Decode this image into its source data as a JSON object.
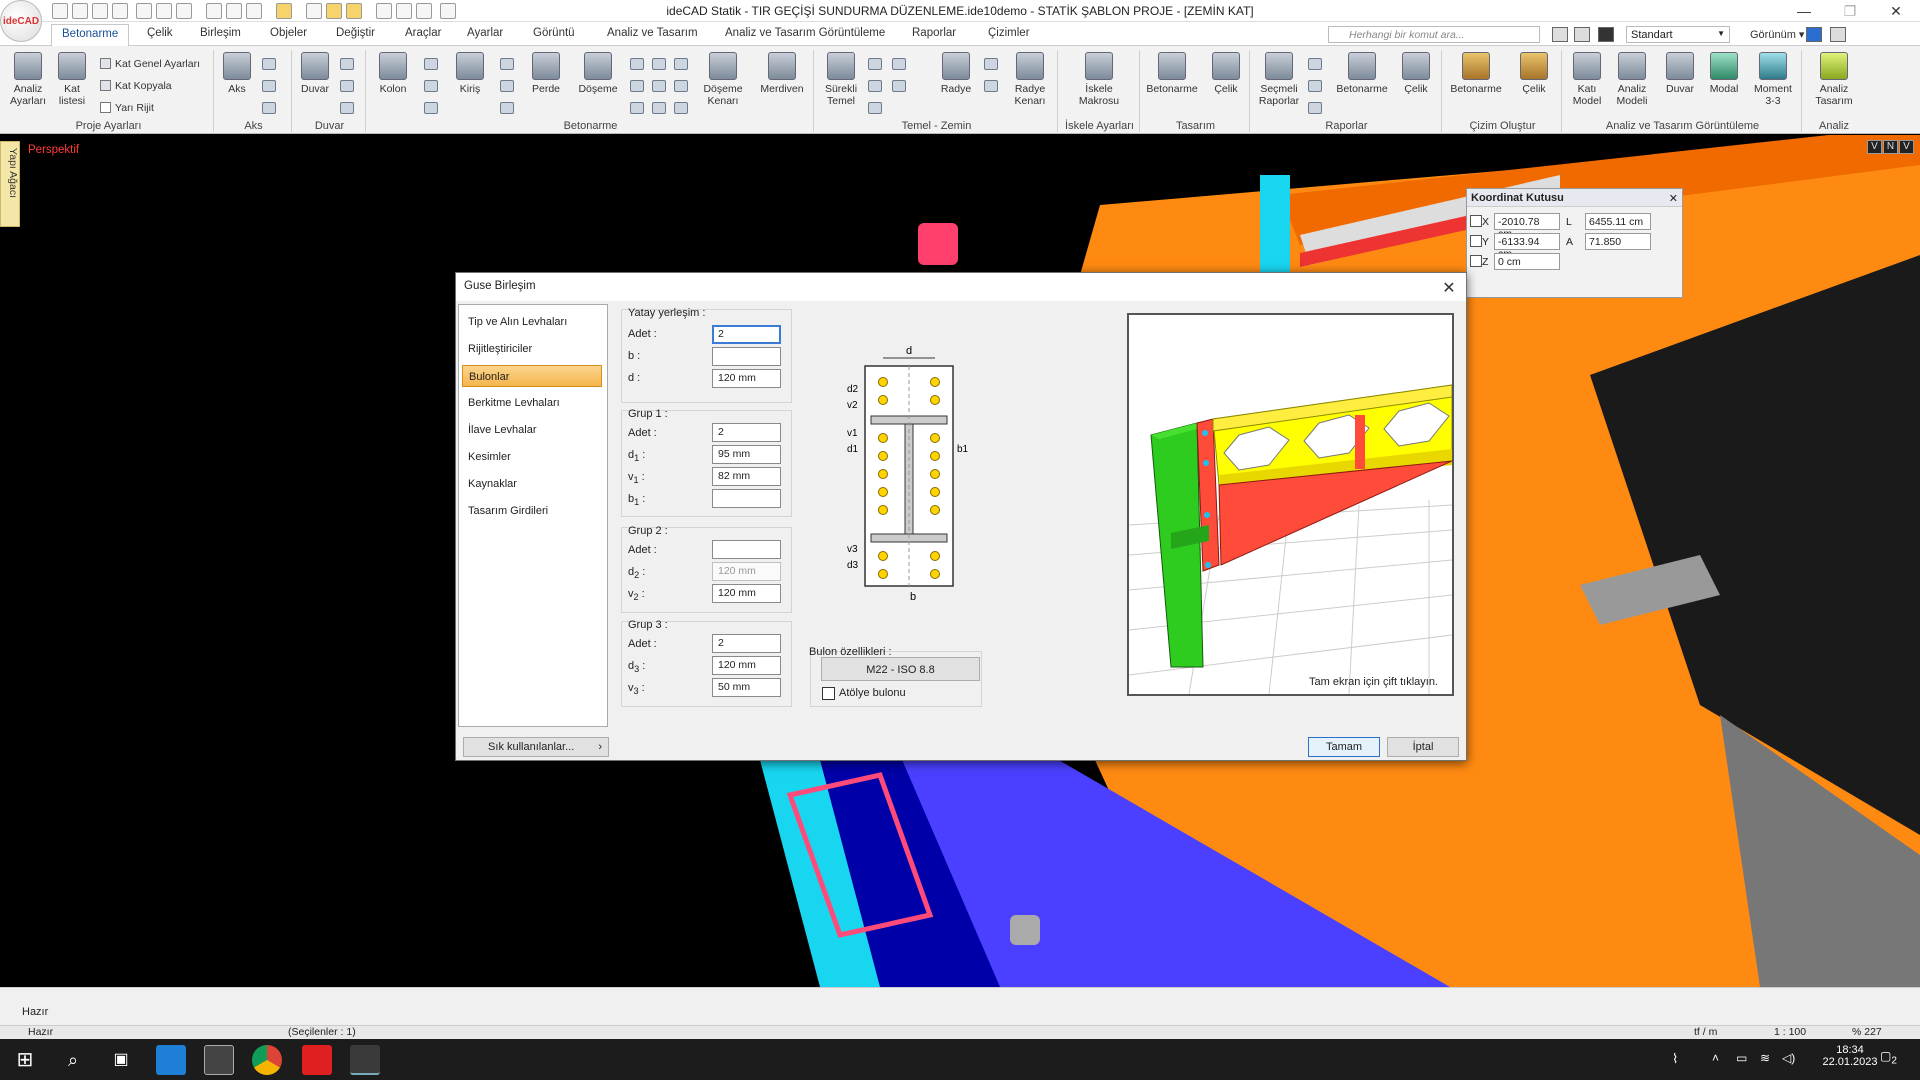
{
  "app": {
    "logo": "ideCAD",
    "title": "ideCAD Statik - TIR GEÇİŞİ SUNDURMA DÜZENLEME.ide10demo - STATİK ŞABLON PROJE - [ZEMİN KAT]",
    "winbtns": {
      "min": "—",
      "max": "❐",
      "close": "✕"
    }
  },
  "menu": {
    "tabs": [
      "Betonarme",
      "Çelik",
      "Birleşim",
      "Objeler",
      "Değiştir",
      "Araçlar",
      "Ayarlar",
      "Görüntü",
      "Analiz ve Tasarım",
      "Analiz ve Tasarım Görüntüleme",
      "Raporlar",
      "Çizimler"
    ],
    "search_placeholder": "Herhangi bir komut ara...",
    "style_value": "Standart",
    "view_label": "Görünüm"
  },
  "ribbon": {
    "groups": {
      "proje": {
        "label": "Proje Ayarları",
        "big": [
          "Analiz Ayarları",
          "Kat listesi"
        ],
        "small": [
          "Kat Genel Ayarları",
          "Kat Kopyala",
          "Yarı Rijit"
        ]
      },
      "aks": {
        "label": "Aks",
        "big": [
          "Aks"
        ]
      },
      "duvar": {
        "label": "Duvar",
        "big": [
          "Duvar"
        ]
      },
      "betonarme": {
        "label": "Betonarme",
        "big": [
          "Kolon",
          "Kiriş",
          "Perde",
          "Döşeme",
          "Döşeme Kenarı",
          "Merdiven"
        ]
      },
      "temel": {
        "label": "Temel - Zemin",
        "big": [
          "Sürekli Temel",
          "Radye",
          "Radye Kenarı"
        ]
      },
      "iskele": {
        "label": "İskele Ayarları",
        "big": [
          "İskele Makrosu"
        ]
      },
      "tasarim": {
        "label": "Tasarım",
        "big": [
          "Betonarme",
          "Çelik"
        ]
      },
      "raporlar": {
        "label": "Raporlar",
        "big": [
          "Seçmeli Raporlar",
          "Betonarme",
          "Çelik"
        ]
      },
      "cizim": {
        "label": "Çizim Oluştur",
        "big": [
          "Betonarme",
          "Çelik"
        ]
      },
      "analizgor": {
        "label": "Analiz ve Tasarım Görüntüleme",
        "big": [
          "Katı Model",
          "Analiz Modeli",
          "Duvar",
          "Modal",
          "Moment 3-3"
        ]
      },
      "analiz": {
        "label": "Analiz",
        "big": [
          "Analiz Tasarım"
        ]
      }
    }
  },
  "viewport": {
    "side_tab": "Yapı Ağacı",
    "perspective_label": "Perspektif",
    "view_buttons": [
      "V",
      "N",
      "V"
    ]
  },
  "coordbox": {
    "title": "Koordinat Kutusu",
    "x_label": "X",
    "x_value": "-2010.78 cm",
    "y_label": "Y",
    "y_value": "-6133.94 cm",
    "z_label": "Z",
    "z_value": "0 cm",
    "l_label": "L",
    "l_value": "6455.11 cm",
    "a_label": "A",
    "a_value": "71.850"
  },
  "dialog": {
    "title": "Guse Birleşim",
    "nav": [
      "Tip ve Alın Levhaları",
      "Rijitleştiriciler",
      "Bulonlar",
      "Berkitme Levhaları",
      "İlave Levhalar",
      "Kesimler",
      "Kaynaklar",
      "Tasarım Girdileri"
    ],
    "yatay": {
      "legend": "Yatay yerleşim :",
      "adet_label": "Adet :",
      "adet": "2",
      "b_label": "b :",
      "b": "",
      "d_label": "d :",
      "d": "120 mm"
    },
    "grup1": {
      "legend": "Grup 1 :",
      "adet_label": "Adet :",
      "adet": "2",
      "d1_label": "d",
      "d1_sub": "1",
      "d1": "95 mm",
      "v1_label": "v",
      "v1_sub": "1",
      "v1": "82 mm",
      "b1_label": "b",
      "b1_sub": "1",
      "b1": ""
    },
    "grup2": {
      "legend": "Grup 2 :",
      "adet_label": "Adet :",
      "adet": "",
      "d2_label": "d",
      "d2_sub": "2",
      "d2": "120 mm",
      "v2_label": "v",
      "v2_sub": "2",
      "v2": "120 mm"
    },
    "grup3": {
      "legend": "Grup 3 :",
      "adet_label": "Adet :",
      "adet": "2",
      "d3_label": "d",
      "d3_sub": "3",
      "d3": "120 mm",
      "v3_label": "v",
      "v3_sub": "3",
      "v3": "50 mm"
    },
    "bolt": {
      "legend": "Bulon özellikleri :",
      "grade": "M22 - ISO 8.8",
      "workshop_label": "Atölye bulonu"
    },
    "drawing": {
      "d": "d",
      "b": "b",
      "d2": "d2",
      "v2": "v2",
      "v1": "v1",
      "d1": "d1",
      "b1": "b1",
      "v3": "v3",
      "d3": "d3"
    },
    "preview_note": "Tam ekran için çift tıklayın.",
    "frequent_button": "Sık kullanılanlar...",
    "ok_button": "Tamam",
    "cancel_button": "İptal"
  },
  "status": {
    "line1": "Hazır",
    "line2": "Hazır",
    "selected": "(Seçilenler : 1)",
    "units": "tf / m",
    "scale": "1 : 100",
    "zoom": "% 227"
  },
  "taskbar": {
    "time": "18:34",
    "date": "22.01.2023",
    "notif": "2"
  }
}
